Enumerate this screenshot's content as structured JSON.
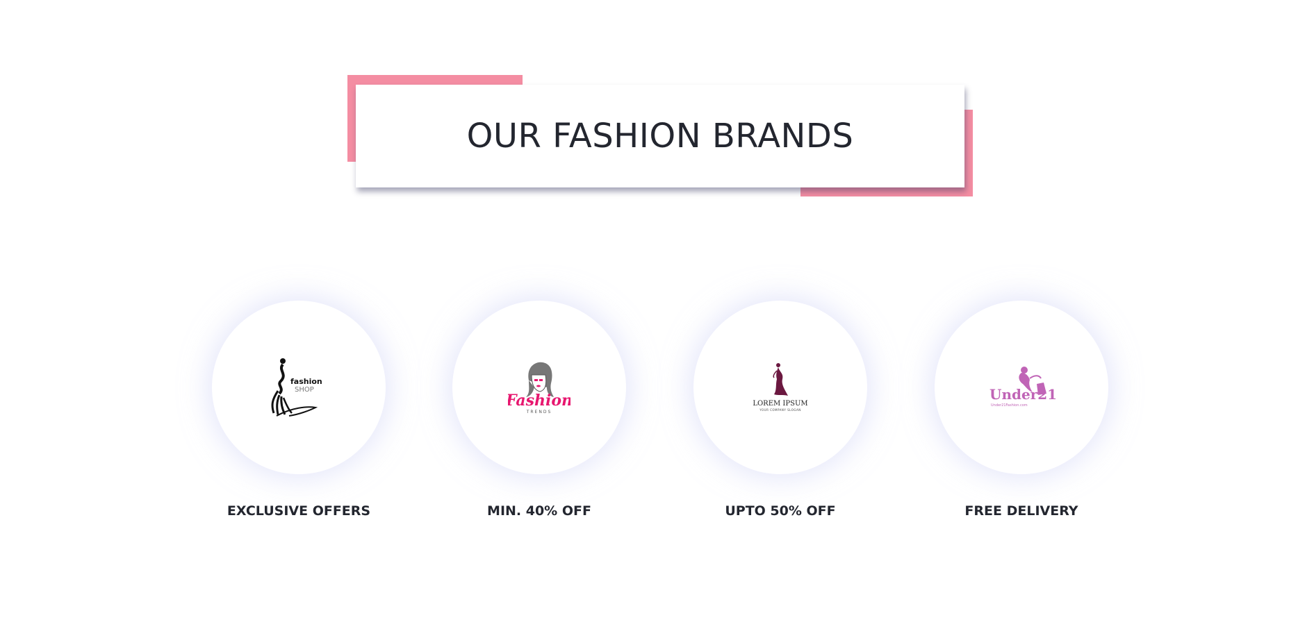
{
  "heading": {
    "title": "OUR FASHION BRANDS"
  },
  "colors": {
    "accent": "#f48da2",
    "heading_text": "#23262f",
    "logo_black": "#111111",
    "logo_pink": "#e7176f",
    "logo_gray": "#777777",
    "logo_maroon": "#6b1840",
    "logo_violet": "#c064b6"
  },
  "brands": [
    {
      "label": "EXCLUSIVE OFFERS",
      "logo_icon": "fashion-shop-logo-icon",
      "logo_text": "fashion",
      "logo_subtext": "SHOP"
    },
    {
      "label": "MIN. 40% OFF",
      "logo_icon": "fashion-trends-logo-icon",
      "logo_text": "Fashion",
      "logo_subtext": "TRENDS"
    },
    {
      "label": "UPTO 50% OFF",
      "logo_icon": "lorem-ipsum-logo-icon",
      "logo_text": "LOREM IPSUM",
      "logo_subtext": "YOUR COMPANY SLOGAN"
    },
    {
      "label": "FREE DELIVERY",
      "logo_icon": "under21-logo-icon",
      "logo_text": "Under21",
      "logo_subtext": "Under21Fashion.com"
    }
  ]
}
